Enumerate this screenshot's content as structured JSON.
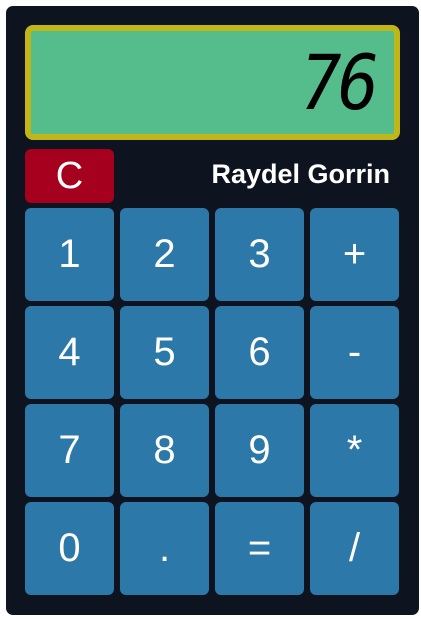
{
  "display": {
    "value": "76"
  },
  "controls": {
    "clear_label": "C",
    "author": "Raydel Gorrin"
  },
  "keys": [
    {
      "label": "1",
      "name": "key-1"
    },
    {
      "label": "2",
      "name": "key-2"
    },
    {
      "label": "3",
      "name": "key-3"
    },
    {
      "label": "+",
      "name": "key-plus"
    },
    {
      "label": "4",
      "name": "key-4"
    },
    {
      "label": "5",
      "name": "key-5"
    },
    {
      "label": "6",
      "name": "key-6"
    },
    {
      "label": "-",
      "name": "key-minus"
    },
    {
      "label": "7",
      "name": "key-7"
    },
    {
      "label": "8",
      "name": "key-8"
    },
    {
      "label": "9",
      "name": "key-9"
    },
    {
      "label": "*",
      "name": "key-multiply"
    },
    {
      "label": "0",
      "name": "key-0"
    },
    {
      "label": ".",
      "name": "key-decimal"
    },
    {
      "label": "=",
      "name": "key-equals"
    },
    {
      "label": "/",
      "name": "key-divide"
    }
  ],
  "colors": {
    "body": "#0e1320",
    "display_bg": "#55bc8c",
    "display_border": "#c1b618",
    "clear_button": "#a5001e",
    "key": "#2c78a8"
  }
}
